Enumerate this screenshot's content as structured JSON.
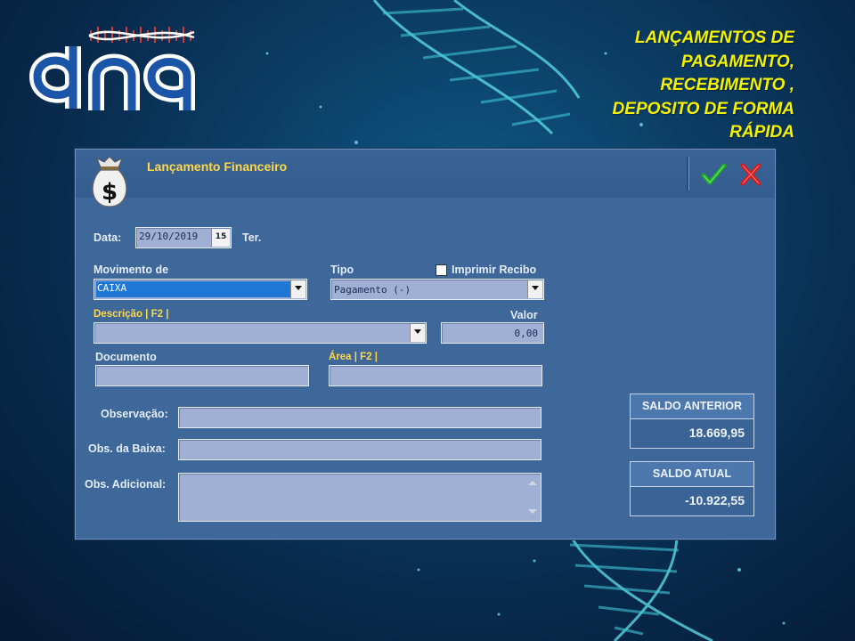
{
  "banner": {
    "lines": [
      "LANÇAMENTOS DE",
      "PAGAMENTO,",
      "RECEBIMENTO ,",
      "DEPOSITO DE FORMA",
      "RÁPIDA"
    ],
    "color": "#f5f200"
  },
  "logo": {
    "text": "dna",
    "icon": "dna-logo"
  },
  "window": {
    "title": "Lançamento Financeiro",
    "icon": "money-bag-icon",
    "ok_icon": "check-icon",
    "cancel_icon": "close-icon"
  },
  "form": {
    "data_label": "Data:",
    "data_value": "29/10/2019",
    "calendar_icon_text": "15",
    "weekday": "Ter.",
    "movimento_label": "Movimento de",
    "movimento_value": "CAIXA",
    "tipo_label": "Tipo",
    "imprimir_label": "Imprimir Recibo",
    "imprimir_checked": false,
    "tipo_value": "Pagamento  (-)",
    "descricao_label": "Descrição | F2 |",
    "descricao_value": "",
    "valor_label": "Valor",
    "valor_value": "0,00",
    "documento_label": "Documento",
    "documento_value": "",
    "area_label": "Área | F2 |",
    "area_value": "",
    "observacao_label": "Observação:",
    "observacao_value": "",
    "obs_baixa_label": "Obs. da Baixa:",
    "obs_baixa_value": "",
    "obs_adicional_label": "Obs. Adicional:",
    "obs_adicional_value": ""
  },
  "saldo": {
    "anterior_label": "SALDO ANTERIOR",
    "anterior_value": "18.669,95",
    "atual_label": "SALDO ATUAL",
    "atual_value": "-10.922,55"
  },
  "colors": {
    "label_yellow": "#ffd84a",
    "window_bg": "#3e679a",
    "field_bg": "#9fb0d4"
  }
}
